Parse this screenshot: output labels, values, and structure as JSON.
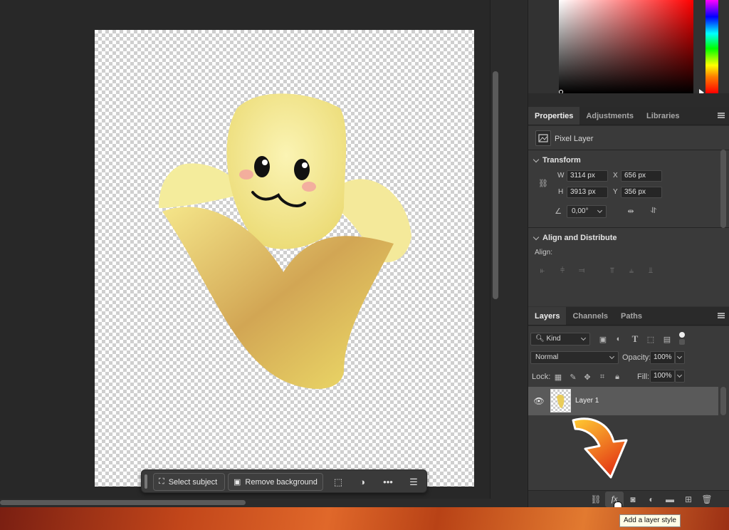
{
  "taskbar": {
    "select_subject": "Select subject",
    "remove_background": "Remove background",
    "more": "•••"
  },
  "properties_tabs": [
    "Properties",
    "Adjustments",
    "Libraries"
  ],
  "properties": {
    "layer_kind": "Pixel Layer",
    "transform_title": "Transform",
    "w_label": "W",
    "w_value": "3114 px",
    "h_label": "H",
    "h_value": "3913 px",
    "x_label": "X",
    "x_value": "656 px",
    "y_label": "Y",
    "y_value": "356 px",
    "angle_value": "0,00°",
    "align_title": "Align and Distribute",
    "align_label": "Align:"
  },
  "layers_tabs": [
    "Layers",
    "Channels",
    "Paths"
  ],
  "layers": {
    "filter_kind": "Kind",
    "blend_mode": "Normal",
    "opacity_label": "Opacity:",
    "opacity_value": "100%",
    "lock_label": "Lock:",
    "fill_label": "Fill:",
    "fill_value": "100%",
    "items": [
      {
        "name": "Layer 1"
      }
    ]
  },
  "tooltip": "Add a layer style",
  "icons": {
    "fx": "fx",
    "text_tool": "T"
  }
}
